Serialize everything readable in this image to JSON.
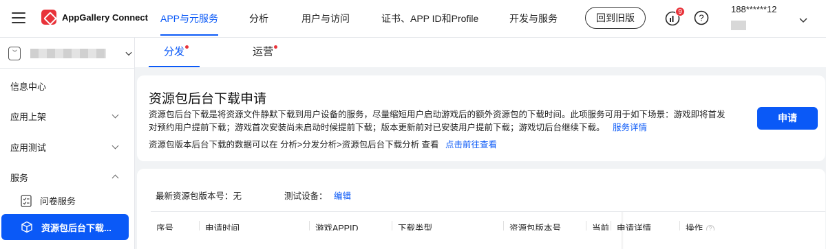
{
  "header": {
    "brand": "AppGallery Connect",
    "nav": [
      {
        "label": "APP与元服务",
        "active": true
      },
      {
        "label": "分析",
        "active": false
      },
      {
        "label": "用户与访问",
        "active": false
      },
      {
        "label": "证书、APP ID和Profile",
        "active": false
      },
      {
        "label": "开发与服务",
        "active": false
      }
    ],
    "old_version_label": "回到旧版",
    "notification_count": "9",
    "user_phone": "188******12"
  },
  "subtabs": [
    {
      "label": "分发",
      "active": true
    },
    {
      "label": "运营",
      "active": false
    }
  ],
  "sidebar": {
    "items": [
      {
        "label": "信息中心"
      },
      {
        "label": "应用上架"
      },
      {
        "label": "应用测试"
      },
      {
        "label": "服务"
      }
    ],
    "sub_items": [
      {
        "label": "问卷服务"
      },
      {
        "label": "资源包后台下载..."
      }
    ]
  },
  "card": {
    "title": "资源包后台下载申请",
    "desc": "资源包后台下载是将资源文件静默下载到用户设备的服务，尽量缩短用户启动游戏后的额外资源包的下载时间。此项服务可用于如下场景：游戏即将首发对预约用户提前下载；游戏首次安装尚未启动时候提前下载；版本更新前对已安装用户提前下载；游戏切后台继续下载。",
    "service_link": "服务详情",
    "desc2": "资源包版本后台下载的数据可以在 分析>分发分析>资源包后台下载分析 查看",
    "view_link": "点击前往查看",
    "apply_label": "申请"
  },
  "info": {
    "version_label": "最新资源包版本号：无",
    "device_label": "测试设备：",
    "edit_link": "编辑"
  },
  "table": {
    "headers": [
      "序号",
      "申请时间",
      "游戏APPID",
      "下载类型",
      "资源包版本号",
      "当前",
      "申请详情",
      "操作"
    ]
  },
  "colors": {
    "accent": "#0a59f7",
    "badge": "#e8333a"
  }
}
